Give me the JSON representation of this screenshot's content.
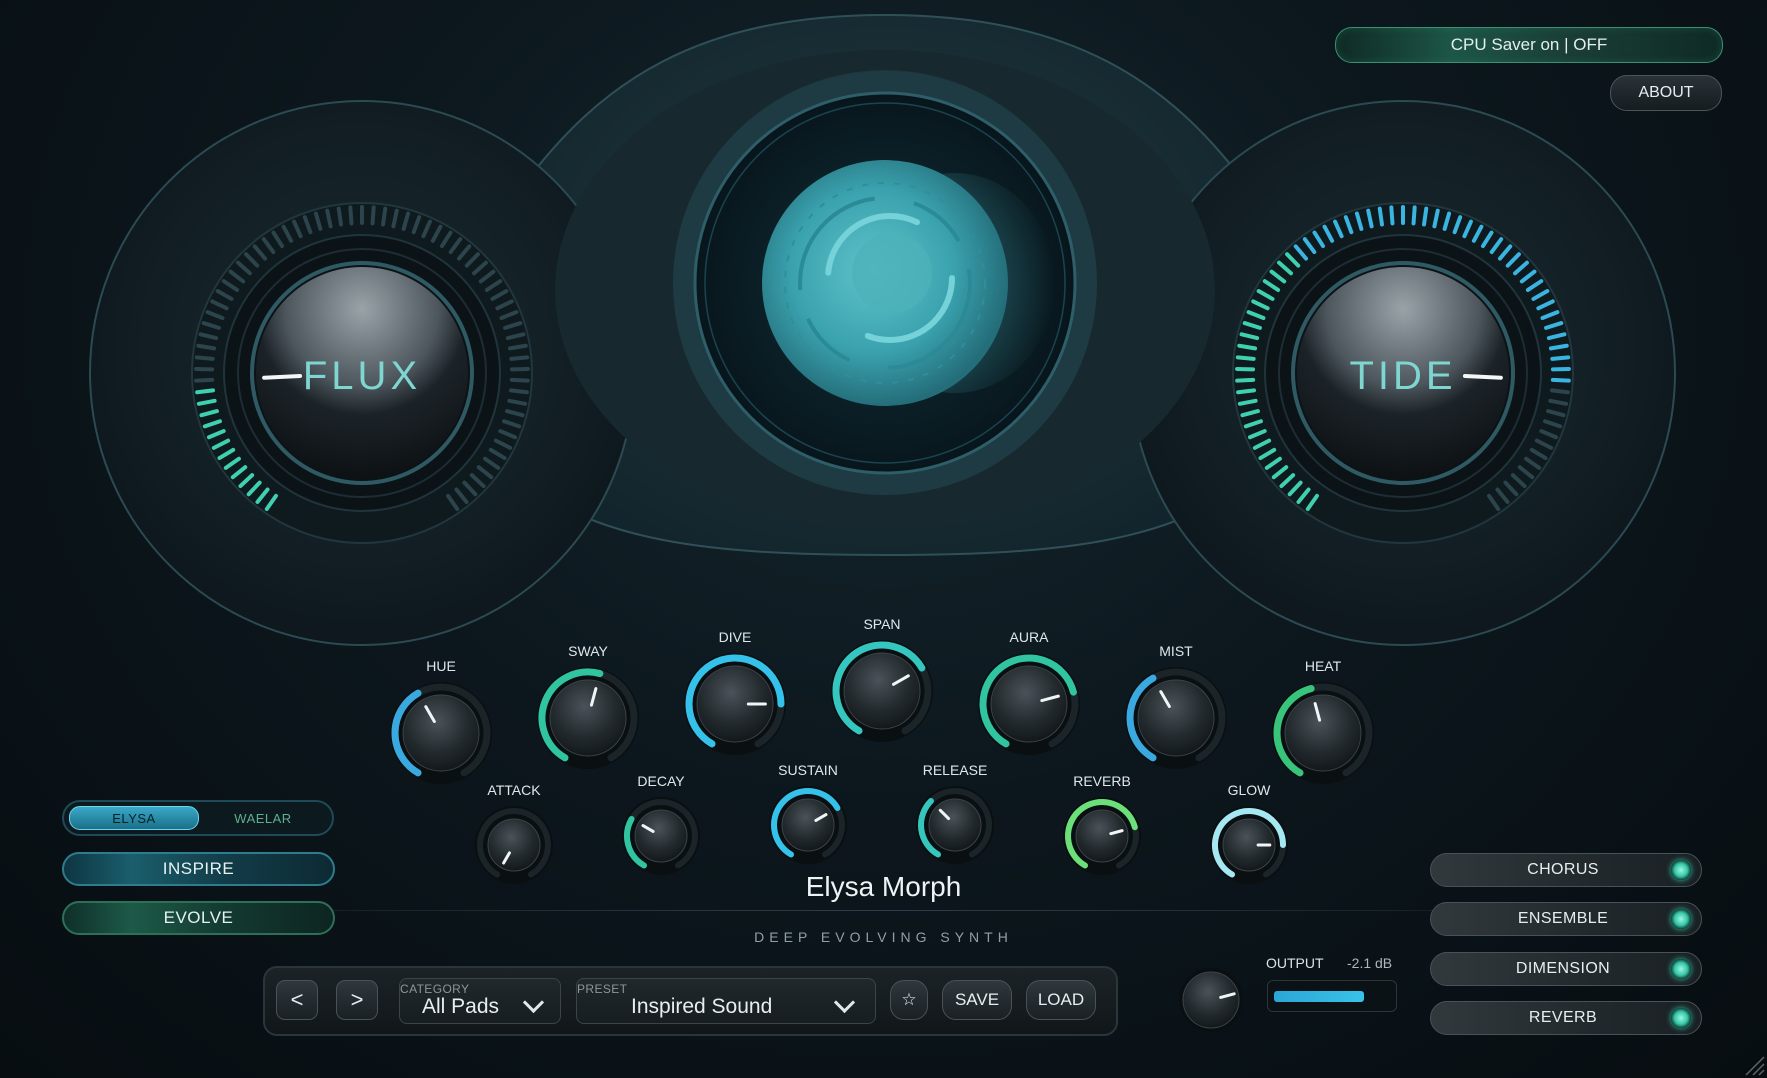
{
  "header": {
    "cpu_saver_label": "CPU Saver on | OFF",
    "about_label": "ABOUT"
  },
  "macros": {
    "left": {
      "label": "FLUX",
      "value": 0.18
    },
    "right": {
      "label": "TIDE",
      "value": 0.82
    }
  },
  "knobs_top": [
    {
      "label": "HUE",
      "value": 0.4,
      "color": "#3aa9e0"
    },
    {
      "label": "SWAY",
      "value": 0.55,
      "color": "#30c4a0"
    },
    {
      "label": "DIVE",
      "value": 0.8,
      "color": "#35c2ea"
    },
    {
      "label": "SPAN",
      "value": 0.7,
      "color": "#35c7bf"
    },
    {
      "label": "AURA",
      "value": 0.75,
      "color": "#30c4a0"
    },
    {
      "label": "MIST",
      "value": 0.4,
      "color": "#3aa9e0"
    },
    {
      "label": "HEAT",
      "value": 0.45,
      "color": "#39c47c"
    }
  ],
  "knobs_bottom": [
    {
      "label": "ATTACK",
      "value": 0.0,
      "color": "#3aa9e0"
    },
    {
      "label": "DECAY",
      "value": 0.3,
      "color": "#30c4a0"
    },
    {
      "label": "SUSTAIN",
      "value": 0.7,
      "color": "#35c2ea"
    },
    {
      "label": "RELEASE",
      "value": 0.35,
      "color": "#35c7bf"
    },
    {
      "label": "REVERB",
      "value": 0.75,
      "color": "#6be07a"
    },
    {
      "label": "GLOW",
      "value": 0.8,
      "color": "#a6e8f2"
    }
  ],
  "engine": {
    "options": [
      "ELYSA",
      "WAELAR"
    ],
    "selected": "ELYSA"
  },
  "left_buttons": {
    "inspire": "INSPIRE",
    "evolve": "EVOLVE"
  },
  "fx": [
    {
      "label": "CHORUS",
      "on": true
    },
    {
      "label": "ENSEMBLE",
      "on": true
    },
    {
      "label": "DIMENSION",
      "on": true
    },
    {
      "label": "REVERB",
      "on": true
    }
  ],
  "preset": {
    "name": "Elysa Morph",
    "tagline": "DEEP EVOLVING SYNTH",
    "prev": "<",
    "next": ">",
    "category_caption": "CATEGORY",
    "category_value": "All Pads",
    "preset_caption": "PRESET",
    "preset_value": "Inspired Sound",
    "favorite_icon": "☆",
    "save": "SAVE",
    "load": "LOAD"
  },
  "output": {
    "label": "OUTPUT",
    "db": "-2.1 dB",
    "level": 0.78,
    "knob_value": 0.75
  },
  "colors": {
    "accent_teal": "#35c2ea",
    "accent_green": "#30c4a0"
  }
}
